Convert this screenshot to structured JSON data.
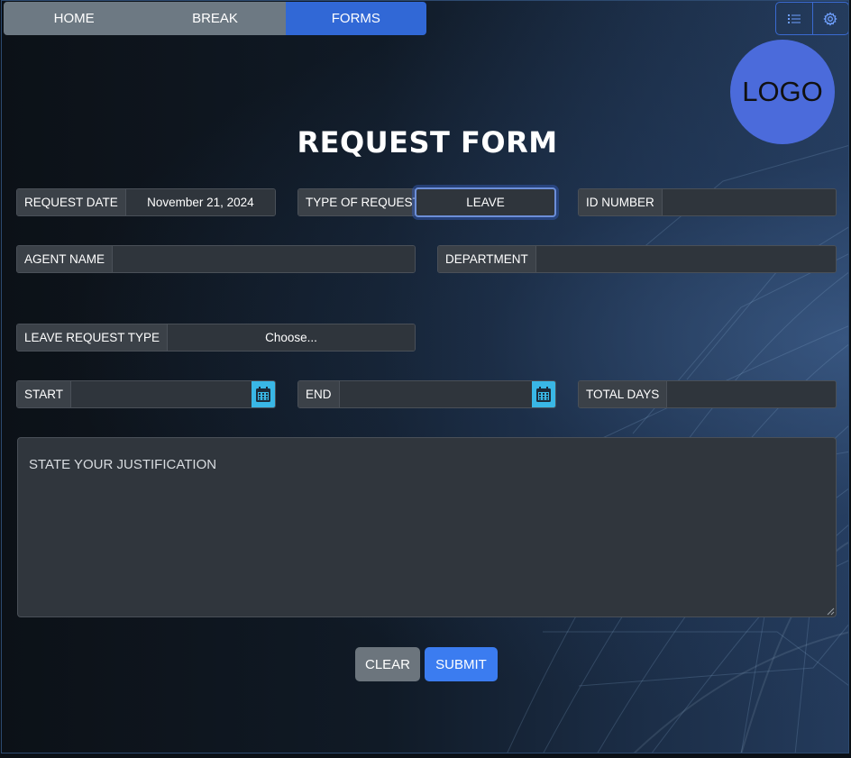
{
  "nav": {
    "tabs": [
      {
        "label": "HOME"
      },
      {
        "label": "BREAK"
      },
      {
        "label": "FORMS"
      }
    ],
    "active": "FORMS"
  },
  "toolbar": {
    "icons": [
      "list-icon",
      "gear-icon"
    ]
  },
  "logo": {
    "text": "LOGO"
  },
  "form": {
    "title": "REQUEST FORM",
    "request_date": {
      "label": "REQUEST DATE",
      "value": "November 21, 2024"
    },
    "type_of_request": {
      "label": "TYPE OF REQUEST",
      "value": "LEAVE"
    },
    "id_number": {
      "label": "ID NUMBER",
      "value": ""
    },
    "agent_name": {
      "label": "AGENT NAME",
      "value": ""
    },
    "department": {
      "label": "DEPARTMENT",
      "value": ""
    },
    "leave_request_type": {
      "label": "LEAVE REQUEST TYPE",
      "value": "Choose..."
    },
    "start": {
      "label": "START",
      "value": ""
    },
    "end": {
      "label": "END",
      "value": ""
    },
    "total_days": {
      "label": "TOTAL DAYS",
      "value": ""
    },
    "justification": {
      "placeholder": "STATE YOUR JUSTIFICATION",
      "value": ""
    }
  },
  "actions": {
    "clear": "CLEAR",
    "submit": "SUBMIT"
  },
  "colors": {
    "accent": "#3168d6",
    "nav_inactive": "#6d7983",
    "logo": "#4b6bdb",
    "calendar": "#39b7e6",
    "submit": "#3b7cf0",
    "clear": "#6c757d"
  }
}
